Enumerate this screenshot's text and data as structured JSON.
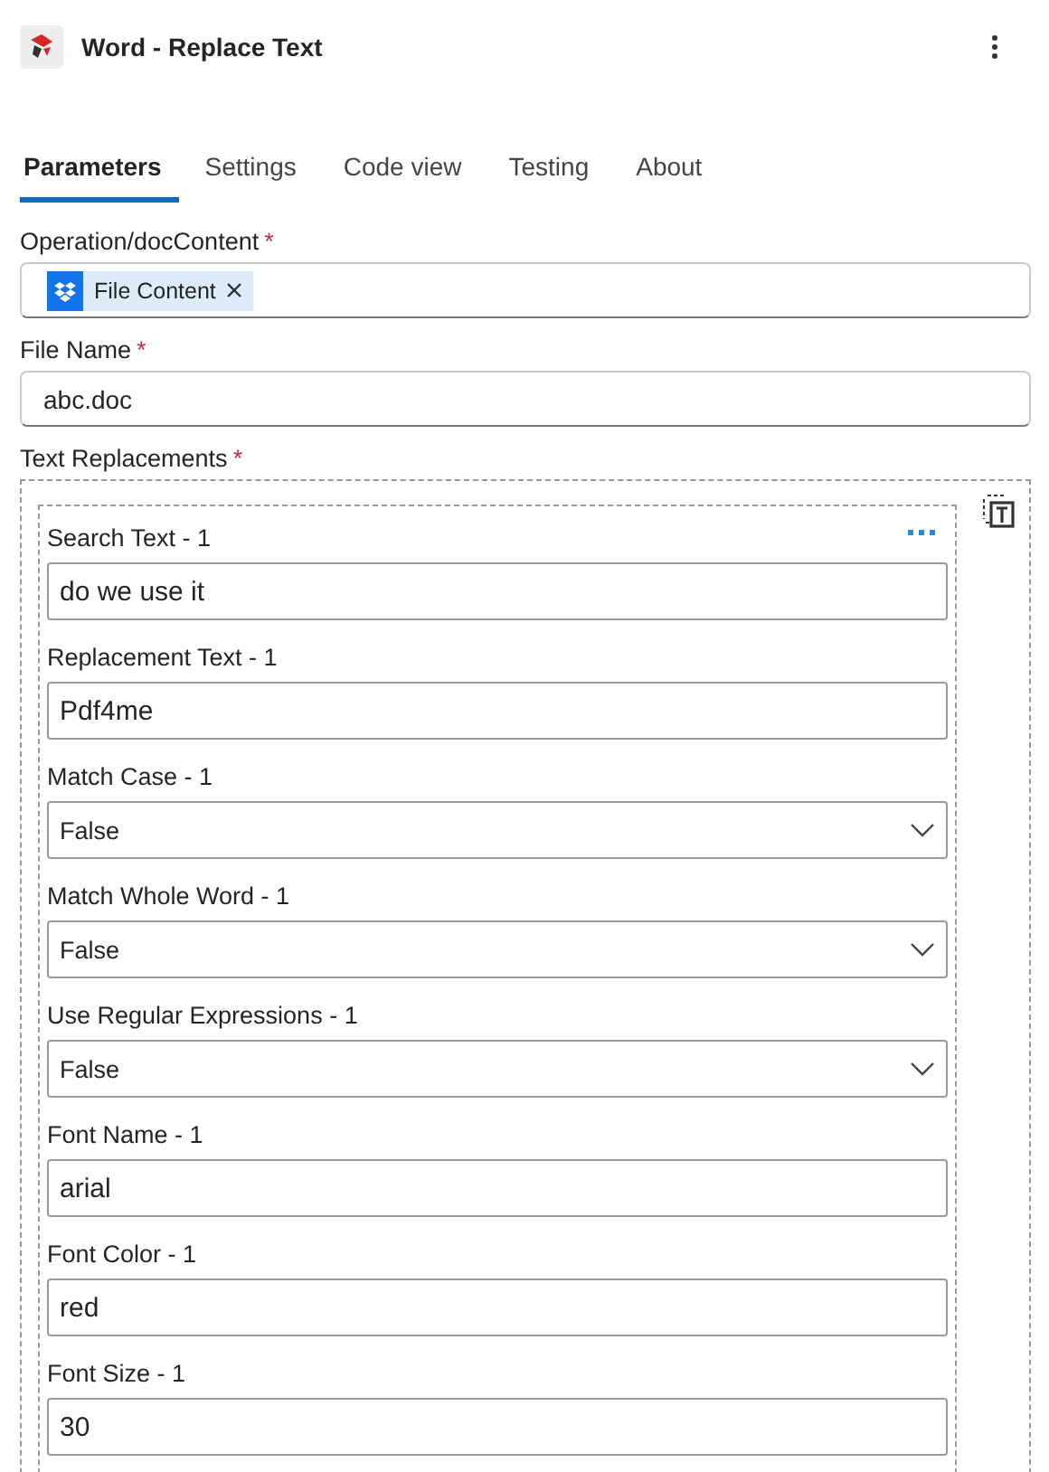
{
  "header": {
    "title": "Word - Replace Text"
  },
  "tabs": [
    {
      "label": "Parameters",
      "selected": true
    },
    {
      "label": "Settings",
      "selected": false
    },
    {
      "label": "Code view",
      "selected": false
    },
    {
      "label": "Testing",
      "selected": false
    },
    {
      "label": "About",
      "selected": false
    }
  ],
  "operation": {
    "label": "Operation/docContent",
    "required": "*",
    "token": "File Content"
  },
  "file_name": {
    "label": "File Name",
    "required": "*",
    "value": "abc.doc"
  },
  "text_replacements": {
    "label": "Text Replacements",
    "required": "*",
    "items": [
      {
        "kind": "text",
        "label": "Search Text - 1",
        "value": "do we use it"
      },
      {
        "kind": "text",
        "label": "Replacement Text - 1",
        "value": "Pdf4me"
      },
      {
        "kind": "select",
        "label": "Match Case - 1",
        "value": "False"
      },
      {
        "kind": "select",
        "label": "Match Whole Word - 1",
        "value": "False"
      },
      {
        "kind": "select",
        "label": "Use Regular Expressions - 1",
        "value": "False"
      },
      {
        "kind": "text",
        "label": "Font Name - 1",
        "value": "arial"
      },
      {
        "kind": "text",
        "label": "Font Color - 1",
        "value": "red"
      },
      {
        "kind": "text",
        "label": "Font Size - 1",
        "value": "30"
      }
    ]
  }
}
